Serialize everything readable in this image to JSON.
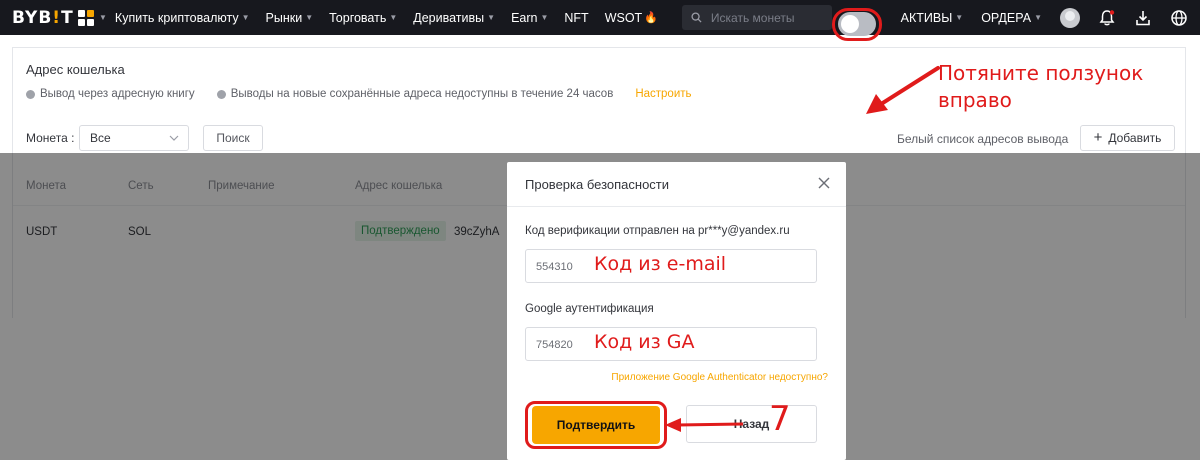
{
  "nav": {
    "logo_prefix": "BYB",
    "logo_mark": "!",
    "logo_suffix": "T",
    "items": [
      {
        "label": "Купить криптовалюту",
        "caret": true
      },
      {
        "label": "Рынки",
        "caret": true
      },
      {
        "label": "Торговать",
        "caret": true
      },
      {
        "label": "Деривативы",
        "caret": true
      },
      {
        "label": "Earn",
        "caret": true
      },
      {
        "label": "NFT",
        "caret": false
      },
      {
        "label": "WSOT",
        "caret": false
      }
    ],
    "search_placeholder": "Искать монеты",
    "assets_label": "АКТИВЫ",
    "orders_label": "ОРДЕРА",
    "icons": [
      "apps-grid-icon",
      "search-icon",
      "avatar",
      "bell-icon",
      "download-icon",
      "globe-icon"
    ],
    "accent_color": "#f7a600",
    "bg_color": "#17181e"
  },
  "wallet": {
    "title": "Адрес кошелька",
    "notes": [
      "Вывод через адресную книгу",
      "Выводы на новые сохранённые адреса недоступны в течение 24 часов"
    ],
    "setup_link": "Настроить"
  },
  "filters": {
    "coin_label": "Монета :",
    "coin_value": "Все",
    "search_button": "Поиск",
    "whitelist_label": "Белый список адресов вывода",
    "whitelist_enabled": false,
    "add_button": "Добавить"
  },
  "table": {
    "headers": [
      "Монета",
      "Сеть",
      "Примечание",
      "Адрес кошелька"
    ],
    "rows": [
      {
        "coin": "USDT",
        "network": "SOL",
        "note": "",
        "status": "Подтверждено",
        "address": "39cZyhA"
      }
    ]
  },
  "modal": {
    "title": "Проверка безопасности",
    "email_label": "Код верификации отправлен на pr***y@yandex.ru",
    "email_code": "554310",
    "ga_label": "Google аутентификация",
    "ga_code": "754820",
    "ga_unavailable_link": "Приложение Google Authenticator недоступно?",
    "confirm_button": "Подтвердить",
    "back_button": "Назад"
  },
  "annotations": {
    "slider_hint_line1": "Потяните ползунок",
    "slider_hint_line2": "вправо",
    "email_hint": "Код из e-mail",
    "ga_hint": "Код из GA",
    "step": "7",
    "color": "#e01b1b"
  }
}
